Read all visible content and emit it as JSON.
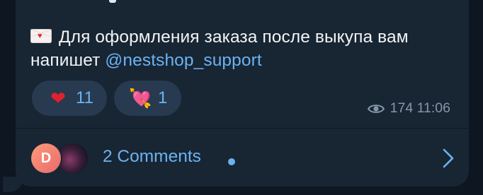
{
  "message": {
    "text": "Для оформления заказа после выкупа вам напишет",
    "mention": "@nestshop_support",
    "leading_emoji": "envelope-with-heart-icon"
  },
  "reactions": [
    {
      "emoji": "❤",
      "icon": "red-heart-icon",
      "count": "11"
    },
    {
      "emoji": "💘",
      "icon": "heart-with-arrow-icon",
      "count": "1"
    }
  ],
  "meta": {
    "views": "174",
    "time": "11:06"
  },
  "comments": {
    "label": "2 Comments",
    "avatar_initial": "D",
    "unread_dot": true
  },
  "colors": {
    "background": "#0e1621",
    "bubble": "#182533",
    "accent": "#6ab3f3",
    "reaction_bg": "#273a4f",
    "meta": "#8697a8"
  }
}
